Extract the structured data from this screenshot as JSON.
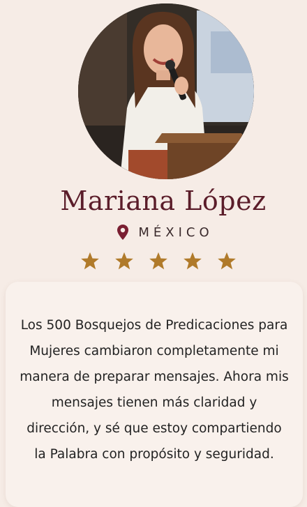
{
  "profile": {
    "name": "Mariana López",
    "location": "MÉXICO",
    "rating": 5,
    "star_color": "#b07a2a",
    "name_color": "#5b1d2a",
    "pin_color": "#7a1f32"
  },
  "testimonial": {
    "text": "Los 500 Bosquejos de Predicaciones para Mujeres cambiaron completamente mi manera de preparar mensajes. Ahora mis mensajes tienen más claridad y dirección, y sé que estoy compartiendo la Palabra con propósito y seguridad."
  }
}
